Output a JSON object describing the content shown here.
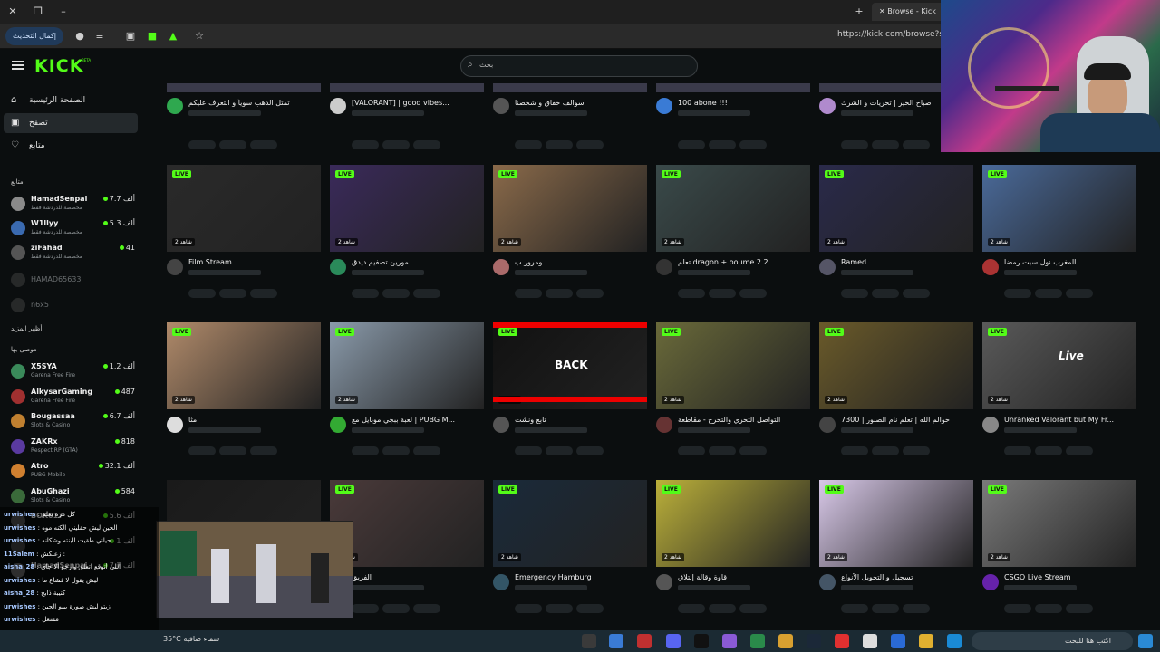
{
  "browser": {
    "tab_title": "Browse - Kick",
    "url": "https://kick.com/browse?sort",
    "update_label": "إكمال التحديث"
  },
  "header": {
    "logo": "KICK",
    "logo_badge": "BETA",
    "search_placeholder": "بحث"
  },
  "sidebar": {
    "nav": [
      {
        "label": "الصفحة الرئيسية",
        "icon": "home-icon"
      },
      {
        "label": "تصفح",
        "icon": "browse-icon"
      },
      {
        "label": "متابع",
        "icon": "heart-icon"
      }
    ],
    "following_title": "متابع",
    "following": [
      {
        "name": "HamadSenpai",
        "game": "مخصصة للدردشة فقط",
        "viewers": "7.7 ألف"
      },
      {
        "name": "W1llyy",
        "game": "مخصصة للدردشة فقط",
        "viewers": "5.3 ألف"
      },
      {
        "name": "ziFahad",
        "game": "مخصصة للدردشة فقط",
        "viewers": "41"
      }
    ],
    "offline": [
      {
        "name": "HAMAD65633"
      },
      {
        "name": "n6x5"
      }
    ],
    "show_more": "أظهر المزيد",
    "recommended_title": "موصى بها",
    "recommended": [
      {
        "name": "X5SYA",
        "game": "Garena Free Fire",
        "viewers": "1.2 ألف"
      },
      {
        "name": "AlkysarGaming",
        "game": "Garena Free Fire",
        "viewers": "487"
      },
      {
        "name": "Bougassaa",
        "game": "Slots & Casino",
        "viewers": "6.7 ألف"
      },
      {
        "name": "ZAKRx",
        "game": "Respect RP (GTA)",
        "viewers": "818"
      },
      {
        "name": "Atro",
        "game": "PUBG Mobile",
        "viewers": "32.1 ألف"
      },
      {
        "name": "AbuGhazi",
        "game": "Slots & Casino",
        "viewers": "584"
      },
      {
        "name": "BOK017",
        "game": "",
        "viewers": "5.6 ألف"
      },
      {
        "name": "",
        "game": "",
        "viewers": "1 ألف"
      },
      {
        "name": "HamadSenpai",
        "game": "",
        "viewers": "7.7 ألف"
      }
    ]
  },
  "top_row": [
    {
      "title": "تمثل الذهب سوياً و التعرف عليكم",
      "avatar": "#2fa84f"
    },
    {
      "title": "[VALORANT] | good vibes...",
      "avatar": "#cccccc"
    },
    {
      "title": "سوالف خفاق و شخصنا",
      "avatar": "#555555"
    },
    {
      "title": "100 abone !!!",
      "avatar": "#3a7bd5"
    },
    {
      "title": "صباح الخير | تحريات و الشرك",
      "avatar": "#b08acd"
    }
  ],
  "streams": [
    {
      "title": "Film Stream",
      "viewers": "2 شاهد",
      "bg": "#2a2a2a",
      "avatar": "#444"
    },
    {
      "title": "مورين تصفيم ديدق",
      "viewers": "2 شاهد",
      "bg": "#3a2a5a",
      "avatar": "#2a8a5a"
    },
    {
      "title": "ومرور ب",
      "viewers": "2 شاهد",
      "bg": "#8a6a4a",
      "avatar": "#aa6a6a"
    },
    {
      "title": "تعلم dragon + ooume 2.2",
      "viewers": "2 شاهد",
      "bg": "#3a4a4a",
      "avatar": "#333"
    },
    {
      "title": "Ramed",
      "viewers": "2 شاهد",
      "bg": "#2a2a4a",
      "avatar": "#556"
    },
    {
      "title": "المغرب نول سبت رمضا",
      "viewers": "2 شاهد",
      "bg": "#4a6a9a",
      "avatar": "#a33"
    },
    {
      "title": "مثا",
      "viewers": "2 شاهد",
      "bg": "#b08a6a",
      "avatar": "#ddd"
    },
    {
      "title": "لعبة ببجي موبايل مع | PUBG M...",
      "viewers": "2 شاهد",
      "bg": "#8a9aaa",
      "avatar": "#3a3"
    },
    {
      "title": "تابع ونشت",
      "viewers": "2 شاهد",
      "bg": "#111111",
      "avatar": "#555"
    },
    {
      "title": "التواصل التحري والتحرح - مقاطعة",
      "viewers": "2 شاهد",
      "bg": "#6a6a3a",
      "avatar": "#633"
    },
    {
      "title": "حوالم الله | تعلم نام الصبور | 7300",
      "viewers": "2 شاهد",
      "bg": "#6a5a2a",
      "avatar": "#444"
    },
    {
      "title": "Unranked Valorant but My Fr...",
      "viewers": "2 شاهد",
      "bg": "#5a5a5a",
      "avatar": "#888"
    },
    {
      "title": "",
      "viewers": "",
      "bg": "#1a1a1a",
      "avatar": "#333"
    },
    {
      "title": "الفريق",
      "viewers": "2 شاهد",
      "bg": "#4a3a3a",
      "avatar": "#555"
    },
    {
      "title": "Emergency Hamburg",
      "viewers": "2 شاهد",
      "bg": "#1a2a3a",
      "avatar": "#356"
    },
    {
      "title": "قاوة وقالة إنتلاق",
      "viewers": "2 شاهد",
      "bg": "#bbb03a",
      "avatar": "#555"
    },
    {
      "title": "تسجيل و التحويل الأنواع",
      "viewers": "2 شاهد",
      "bg": "#d8c8e8",
      "avatar": "#456"
    },
    {
      "title": "CSGO Live Stream",
      "viewers": "2 شاهد",
      "bg": "#7a7a7a",
      "avatar": "#62a"
    }
  ],
  "thumb_texts": {
    "back": "BACK",
    "live_text": "Live"
  },
  "live_label": "LIVE",
  "chat": [
    {
      "user": "urwishes",
      "text": "كل مره تعلم"
    },
    {
      "user": "urwishes",
      "text": "الحين ليش حقليني الكنه موه"
    },
    {
      "user": "urwishes",
      "text": "حياني طقيت البنته وشكانه"
    },
    {
      "user": "11Salem",
      "text": "زعلكش :"
    },
    {
      "user": "aisha_28",
      "text": "اللي أتوقع اتعلق وارجع الا جاي"
    },
    {
      "user": "urwishes",
      "text": "ليش يقول لا فشاع ما"
    },
    {
      "user": "aisha_28",
      "text": "كتيبة ذابح"
    },
    {
      "user": "urwishes",
      "text": "زيتو ليش صورة بيبو الحين"
    },
    {
      "user": "urwishes",
      "text": "مشغل"
    }
  ],
  "taskbar": {
    "weather": "35°C  سماء صافية",
    "search_placeholder": "اكتب هنا للبحث"
  }
}
